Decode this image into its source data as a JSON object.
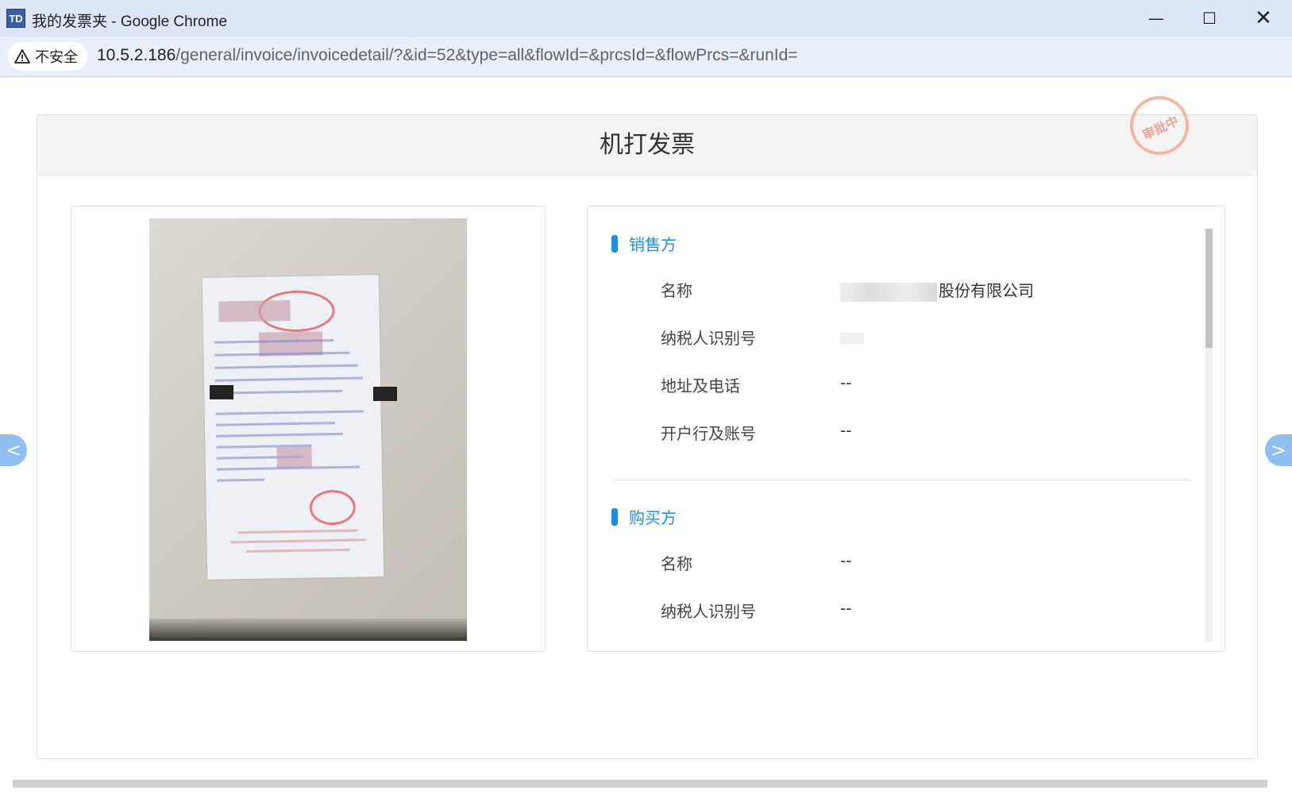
{
  "window": {
    "title": "我的发票夹 - Google Chrome",
    "app_icon_text": "TD",
    "minimize": "—",
    "maximize": "☐",
    "close": "✕"
  },
  "address_bar": {
    "security_icon": "warning-icon",
    "security_label": "不安全",
    "url_host": "10.5.2.186",
    "url_path": "/general/invoice/invoicedetail/?&id=52&type=all&flowId=&prcsId=&flowPrcs=&runId="
  },
  "page": {
    "title": "机打发票",
    "approval_stamp": "审批中",
    "prev_arrow": "<",
    "next_arrow": ">"
  },
  "seller": {
    "heading": "销售方",
    "name_label": "名称",
    "name_value": "股份有限公司",
    "tax_id_label": "纳税人识别号",
    "address_label": "地址及电话",
    "address_value": "--",
    "bank_label": "开户行及账号",
    "bank_value": "--"
  },
  "buyer": {
    "heading": "购买方",
    "name_label": "名称",
    "name_value": "--",
    "tax_id_label": "纳税人识别号",
    "tax_id_value": "--"
  },
  "colors": {
    "accent": "#1a8fe8",
    "header_bg": "#f4f4f4",
    "nav_arrow": "#8fbff2"
  }
}
